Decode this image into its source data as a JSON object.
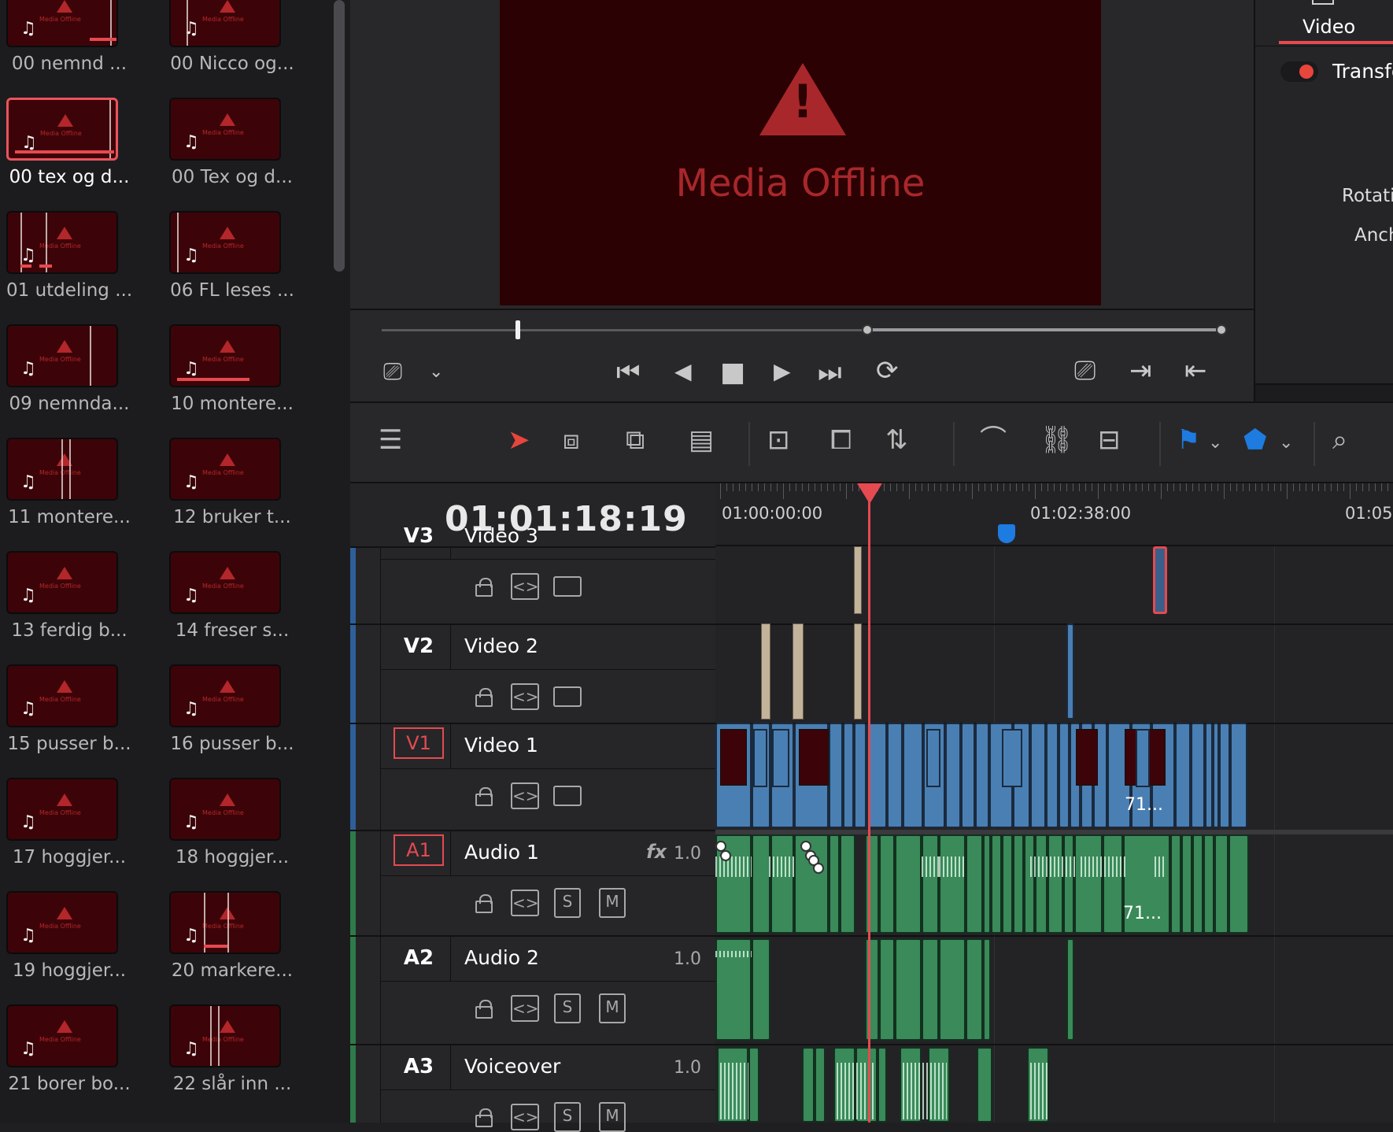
{
  "media_pool": {
    "clips": [
      {
        "name": "00 nemnd ...",
        "selected": false
      },
      {
        "name": "00 Nicco og...",
        "selected": false
      },
      {
        "name": "00 tex og d...",
        "selected": true
      },
      {
        "name": "00 Tex og d...",
        "selected": false
      },
      {
        "name": "01 utdeling ...",
        "selected": false
      },
      {
        "name": "06 FL leses ...",
        "selected": false
      },
      {
        "name": "09 nemnda...",
        "selected": false
      },
      {
        "name": "10 montere...",
        "selected": false
      },
      {
        "name": "11 montere...",
        "selected": false
      },
      {
        "name": "12 bruker t...",
        "selected": false
      },
      {
        "name": "13 ferdig b...",
        "selected": false
      },
      {
        "name": "14 freser s...",
        "selected": false
      },
      {
        "name": "15 pusser b...",
        "selected": false
      },
      {
        "name": "16 pusser b...",
        "selected": false
      },
      {
        "name": "17 hoggjer...",
        "selected": false
      },
      {
        "name": "18 hoggjer...",
        "selected": false
      },
      {
        "name": "19 hoggjer...",
        "selected": false
      },
      {
        "name": "20 markere...",
        "selected": false
      },
      {
        "name": "21 borer bo...",
        "selected": false
      },
      {
        "name": "22 slår inn ...",
        "selected": false
      }
    ],
    "thumb_warning": "Media Offline"
  },
  "viewer": {
    "offline_message": "Media Offline",
    "controls": {
      "first": "⏮",
      "prev": "◀",
      "stop": "■",
      "play": "▶",
      "last": "⏭",
      "loop": "⟳",
      "clip_view": "⎚",
      "in": "⇥",
      "out": "⇤"
    }
  },
  "inspector": {
    "tab": "Video",
    "section": "Transform",
    "rotation_label": "Rotation",
    "anchor_label": "Anchor"
  },
  "toolbar": {
    "icons": [
      "timeline-view-icon",
      "pointer-icon",
      "trim-icon",
      "dynamic-trim-icon",
      "blade-icon",
      "insert-icon",
      "overwrite-icon",
      "replace-icon",
      "snapping-icon",
      "link-icon",
      "position-lock-icon",
      "flag-icon",
      "marker-icon",
      "zoom-icon"
    ]
  },
  "timeline": {
    "timecode": "01:01:18:19",
    "ruler": [
      "01:00:00:00",
      "01:02:38:00",
      "01:05"
    ],
    "tracks": [
      {
        "id": "V3",
        "name": "Video 3",
        "kind": "video"
      },
      {
        "id": "V2",
        "name": "Video 2",
        "kind": "video"
      },
      {
        "id": "V1",
        "name": "Video 1",
        "kind": "video"
      },
      {
        "id": "A1",
        "name": "Audio 1",
        "kind": "audio",
        "fx": "fx",
        "volume": "1.0"
      },
      {
        "id": "A2",
        "name": "Audio 2",
        "kind": "audio",
        "volume": "1.0"
      },
      {
        "id": "A3",
        "name": "Voiceover",
        "kind": "audio",
        "volume": "1.0"
      }
    ],
    "ctrl_s": "S",
    "ctrl_m": "M",
    "clip_label_v1": "71...",
    "clip_label_a1": "71..."
  }
}
